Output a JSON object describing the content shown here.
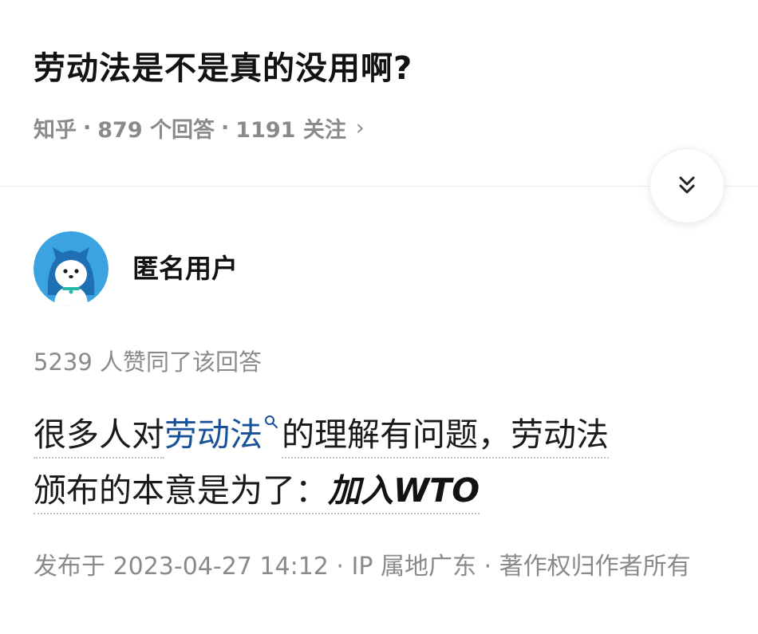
{
  "question": {
    "title": "劳动法是不是真的没用啊?",
    "source": "知乎",
    "answer_count": "879 个回答",
    "follower_count": "1191 关注",
    "separator": "·",
    "chevron": "›"
  },
  "answer": {
    "author_name": "匿名用户",
    "upvote_text": "5239 人赞同了该回答",
    "line1_before": "很多人对",
    "line1_link": "劳动法",
    "line1_after": "的理解有问题，劳动法",
    "line2_text": "颁布的本意是为了：",
    "line2_emphasis": "加入WTO",
    "publish_info": "发布于 2023-04-27 14:12 · IP 属地广东 · 著作权归作者所有"
  },
  "icons": {
    "collapse": "double-chevron-down-icon",
    "avatar": "anonymous-user-avatar",
    "search": "search-icon"
  },
  "colors": {
    "link": "#175199",
    "meta": "#8a8a8a",
    "title": "#121212",
    "avatar_bg": "#3aa3e0"
  }
}
